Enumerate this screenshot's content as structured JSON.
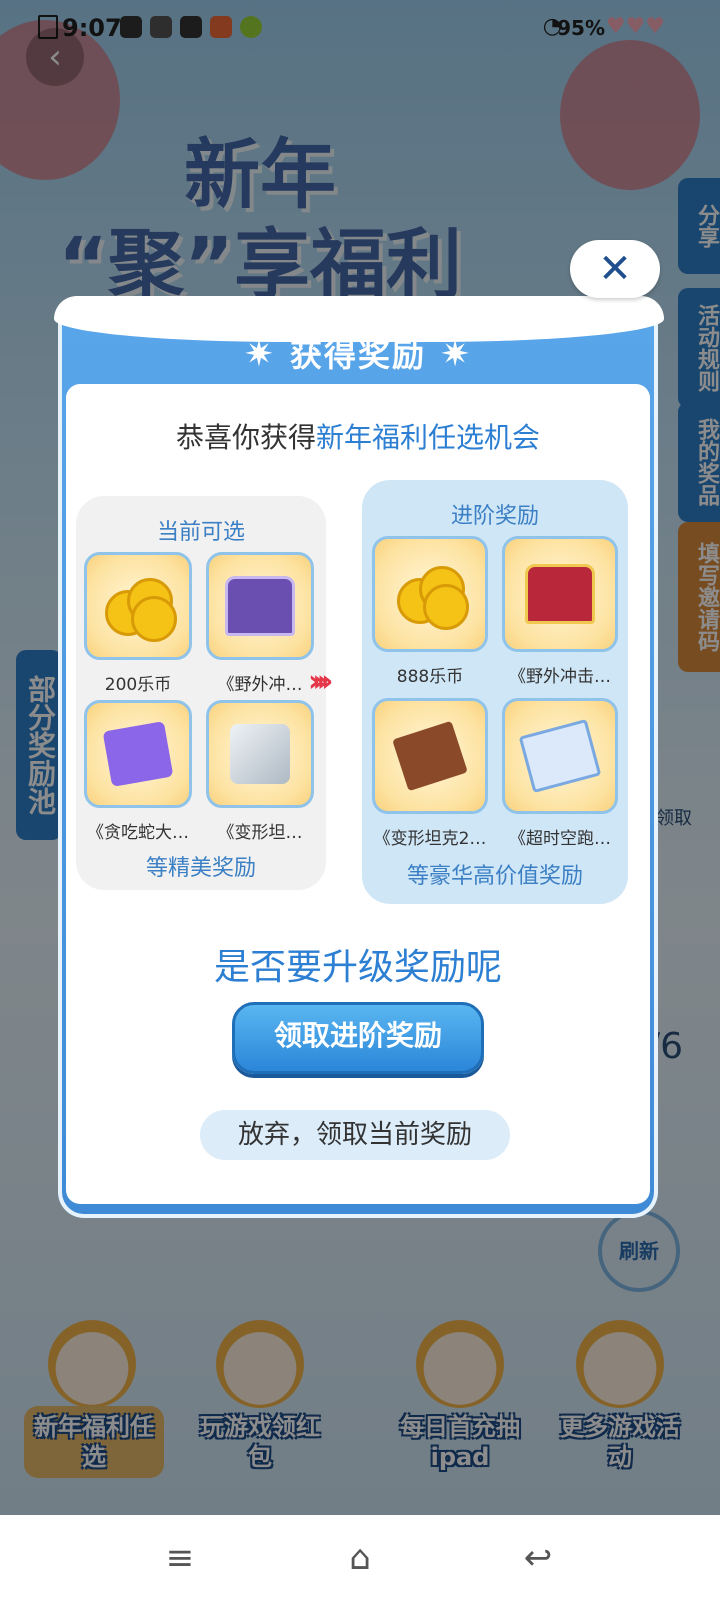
{
  "status_bar": {
    "time": "9:07",
    "battery": "95%"
  },
  "background": {
    "title_line1": "新年",
    "title_line2": "“聚”享福利",
    "side_tabs": [
      "分享",
      "活动规则",
      "我的奖品",
      "填写邀请码"
    ],
    "left_tab": "部分奖励池",
    "peek_right_text": "领取",
    "page_counter": "/6",
    "refresh_label": "刷新",
    "features": [
      "新年福利任选",
      "玩游戏领红包",
      "每日首充抽ipad",
      "更多游戏活动"
    ]
  },
  "dialog": {
    "title": "获得奖励",
    "congrats_prefix": "恭喜你获得",
    "congrats_highlight": "新年福利任选机会",
    "current": {
      "header": "当前可选",
      "footer": "等精美奖励",
      "items": [
        {
          "label": "200乐币",
          "icon": "coins-icon"
        },
        {
          "label": "《野外冲…",
          "icon": "chest-icon"
        },
        {
          "label": "《贪吃蛇大…",
          "icon": "tickets-icon"
        },
        {
          "label": "《变形坦…",
          "icon": "dice-icon"
        }
      ]
    },
    "advanced": {
      "header": "进阶奖励",
      "footer": "等豪华高价值奖励",
      "items": [
        {
          "label": "888乐币",
          "icon": "coins-icon"
        },
        {
          "label": "《野外冲击…",
          "icon": "chest-icon"
        },
        {
          "label": "《变形坦克2…",
          "icon": "gift-box-icon"
        },
        {
          "label": "《超时空跑…",
          "icon": "book-icon"
        }
      ]
    },
    "question": "是否要升级奖励呢",
    "upgrade_button": "领取进阶奖励",
    "giveup_button": "放弃，领取当前奖励"
  },
  "colors": {
    "dialog_blue": "#3f8ad6",
    "accent_text": "#2c7fd2",
    "arrow_red": "#e5364a"
  }
}
